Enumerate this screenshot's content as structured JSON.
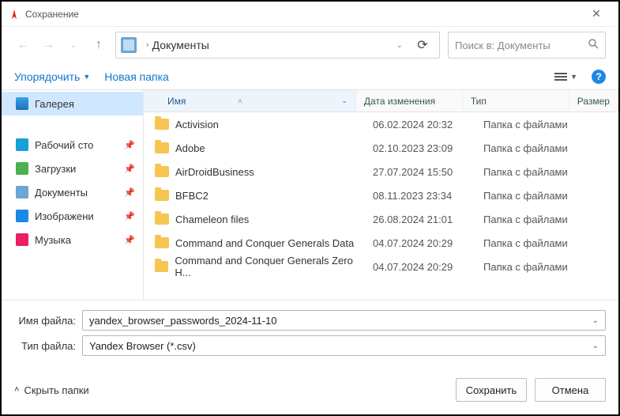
{
  "title": "Сохранение",
  "nav": {
    "location": "Документы",
    "search_placeholder": "Поиск в: Документы"
  },
  "toolbar": {
    "organize": "Упорядочить",
    "new_folder": "Новая папка"
  },
  "sidebar": {
    "gallery": "Галерея",
    "items": [
      {
        "label": "Рабочий сто",
        "color": "#18a0d6"
      },
      {
        "label": "Загрузки",
        "color": "#4caf50"
      },
      {
        "label": "Документы",
        "color": "#6aa6d6"
      },
      {
        "label": "Изображени",
        "color": "#1e88e5"
      },
      {
        "label": "Музыка",
        "color": "#e91e63"
      }
    ]
  },
  "columns": {
    "name": "Имя",
    "date": "Дата изменения",
    "type": "Тип",
    "size": "Размер"
  },
  "files": [
    {
      "name": "Activision",
      "date": "06.02.2024 20:32",
      "type": "Папка с файлами"
    },
    {
      "name": "Adobe",
      "date": "02.10.2023 23:09",
      "type": "Папка с файлами"
    },
    {
      "name": "AirDroidBusiness",
      "date": "27.07.2024 15:50",
      "type": "Папка с файлами"
    },
    {
      "name": "BFBC2",
      "date": "08.11.2023 23:34",
      "type": "Папка с файлами"
    },
    {
      "name": "Chameleon files",
      "date": "26.08.2024 21:01",
      "type": "Папка с файлами"
    },
    {
      "name": "Command and Conquer Generals Data",
      "date": "04.07.2024 20:29",
      "type": "Папка с файлами"
    },
    {
      "name": "Command and Conquer Generals Zero H...",
      "date": "04.07.2024 20:29",
      "type": "Папка с файлами"
    }
  ],
  "form": {
    "filename_label": "Имя файла:",
    "filename_value": "yandex_browser_passwords_2024-11-10",
    "filetype_label": "Тип файла:",
    "filetype_value": "Yandex Browser (*.csv)"
  },
  "footer": {
    "hide": "Скрыть папки",
    "save": "Сохранить",
    "cancel": "Отмена"
  }
}
